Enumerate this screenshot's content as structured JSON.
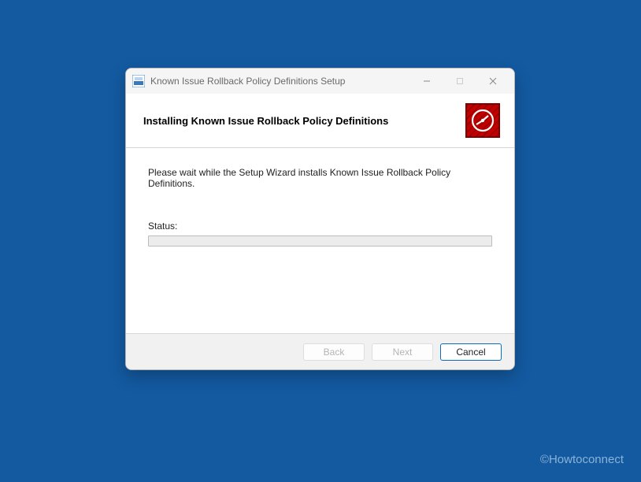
{
  "titlebar": {
    "title": "Known Issue Rollback Policy Definitions Setup"
  },
  "header": {
    "title": "Installing Known Issue Rollback Policy Definitions"
  },
  "content": {
    "wait_text": "Please wait while the Setup Wizard installs Known Issue Rollback Policy Definitions.",
    "status_label": "Status:"
  },
  "footer": {
    "back_label": "Back",
    "next_label": "Next",
    "cancel_label": "Cancel"
  },
  "watermark": "©Howtoconnect"
}
